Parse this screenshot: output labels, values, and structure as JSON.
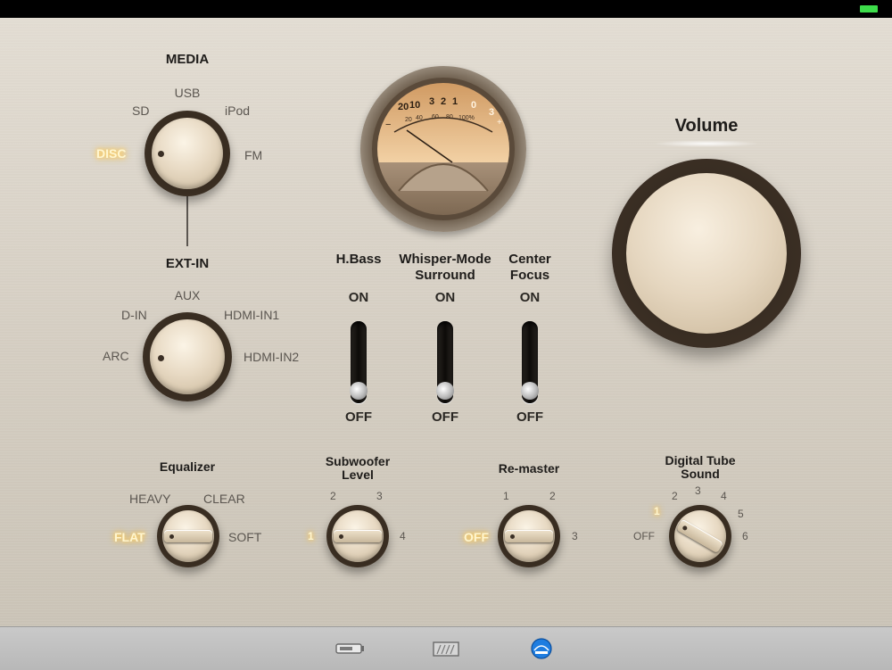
{
  "colors": {
    "battery": "#3ddc4a",
    "active_glow": "#ffd66b",
    "tab_active": "#1e7de0"
  },
  "media": {
    "title": "MEDIA",
    "options": {
      "usb": "USB",
      "sd": "SD",
      "ipod": "iPod",
      "disc": "DISC",
      "fm": "FM"
    },
    "selected": "DISC"
  },
  "ext_in": {
    "title": "EXT-IN",
    "options": {
      "aux": "AUX",
      "d_in": "D-IN",
      "hdmi_in1": "HDMI-IN1",
      "arc": "ARC",
      "hdmi_in2": "HDMI-IN2"
    }
  },
  "meter": {
    "scale_top": [
      "20",
      "10",
      "3",
      "2",
      "1",
      "0",
      "3"
    ],
    "scale_minus": "−",
    "scale_plus": "+",
    "scale_pct": [
      "20",
      "40",
      "60",
      "80",
      "100%"
    ]
  },
  "switches": [
    {
      "title": "H.Bass",
      "on": "ON",
      "off": "OFF",
      "state": "OFF"
    },
    {
      "title_line1": "Whisper-Mode",
      "title_line2": "Surround",
      "on": "ON",
      "off": "OFF",
      "state": "OFF"
    },
    {
      "title_line1": "Center",
      "title_line2": "Focus",
      "on": "ON",
      "off": "OFF",
      "state": "OFF"
    }
  ],
  "volume": {
    "title": "Volume"
  },
  "equalizer": {
    "title": "Equalizer",
    "options": {
      "heavy": "HEAVY",
      "clear": "CLEAR",
      "flat": "FLAT",
      "soft": "SOFT"
    },
    "selected": "FLAT"
  },
  "subwoofer": {
    "title_line1": "Subwoofer",
    "title_line2": "Level",
    "options": [
      "1",
      "2",
      "3",
      "4"
    ],
    "selected": "1"
  },
  "remaster": {
    "title": "Re-master",
    "options": {
      "off": "OFF",
      "one": "1",
      "two": "2",
      "three": "3"
    },
    "selected": "OFF"
  },
  "tube": {
    "title_line1": "Digital Tube",
    "title_line2": "Sound",
    "options": {
      "off": "OFF",
      "one": "1",
      "two": "2",
      "three": "3",
      "four": "4",
      "five": "5",
      "six": "6"
    },
    "selected": "1"
  },
  "tabs": [
    {
      "icon": "device-icon",
      "active": false
    },
    {
      "icon": "equalizer-screen-icon",
      "active": false
    },
    {
      "icon": "amplifier-icon",
      "active": true
    }
  ]
}
